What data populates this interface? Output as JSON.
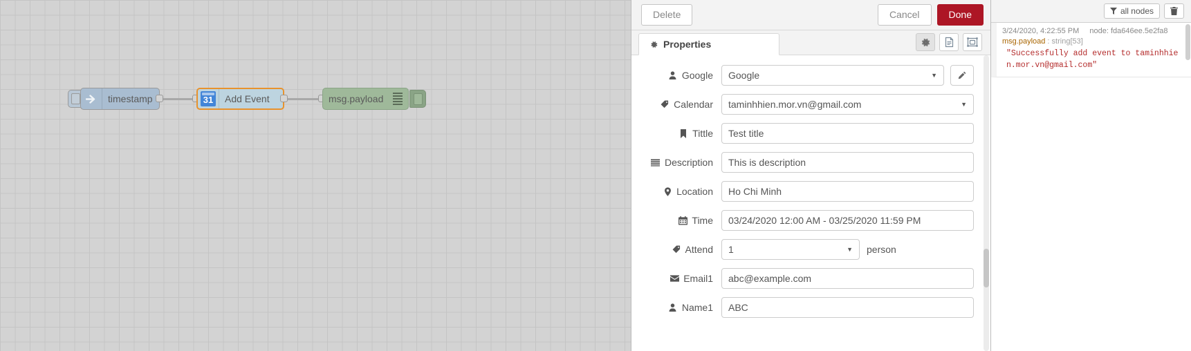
{
  "canvas": {
    "nodes": [
      {
        "name": "inject-node",
        "label": "timestamp",
        "icon": "inject-arrow-icon"
      },
      {
        "name": "gcal-node",
        "label": "Add Event",
        "icon": "calendar-31-icon"
      },
      {
        "name": "debug-node",
        "label": "msg.payload",
        "icon": "debug-lines-icon"
      }
    ]
  },
  "dialog": {
    "toolbar": {
      "delete_label": "Delete",
      "cancel_label": "Cancel",
      "done_label": "Done",
      "done_color": "#ad1625"
    },
    "tabs": {
      "properties_label": "Properties",
      "properties_icon": "gear-icon",
      "icon_buttons": [
        {
          "name": "properties-icon-button",
          "icon": "gear-icon"
        },
        {
          "name": "description-icon-button",
          "icon": "document-icon"
        },
        {
          "name": "appearance-icon-button",
          "icon": "appearance-icon"
        }
      ]
    },
    "fields": [
      {
        "label": "Google",
        "icon": "user-icon",
        "value": "Google",
        "type": "select",
        "has_edit_button": true
      },
      {
        "label": "Calendar",
        "icon": "tag-icon",
        "value": "taminhhien.mor.vn@gmail.com",
        "type": "select"
      },
      {
        "label": "Tittle",
        "icon": "bookmark-icon",
        "value": "Test title",
        "type": "text"
      },
      {
        "label": "Description",
        "icon": "lines-icon",
        "value": "This is description",
        "type": "text"
      },
      {
        "label": "Location",
        "icon": "pin-icon",
        "value": "Ho Chi Minh",
        "type": "text"
      },
      {
        "label": "Time",
        "icon": "calendar-icon",
        "value": "03/24/2020 12:00 AM - 03/25/2020 11:59 PM",
        "type": "text"
      },
      {
        "label": "Attend",
        "icon": "tag-icon",
        "value": "1",
        "type": "select",
        "suffix": "person",
        "narrow": true
      },
      {
        "label": "Email1",
        "icon": "envelope-icon",
        "value": "abc@example.com",
        "type": "text"
      },
      {
        "label": "Name1",
        "icon": "user-icon",
        "value": "ABC",
        "type": "text"
      }
    ]
  },
  "sidebar": {
    "filter_label": "all nodes",
    "filter_icon": "filter-icon",
    "clear_icon": "trash-icon",
    "messages": [
      {
        "timestamp": "3/24/2020, 4:22:55 PM",
        "node": "node: fda646ee.5e2fa8",
        "property": "msg.payload",
        "meta": " : string[53]",
        "body": "\"Successfully add event to taminhhien.mor.vn@gmail.com\""
      }
    ]
  }
}
